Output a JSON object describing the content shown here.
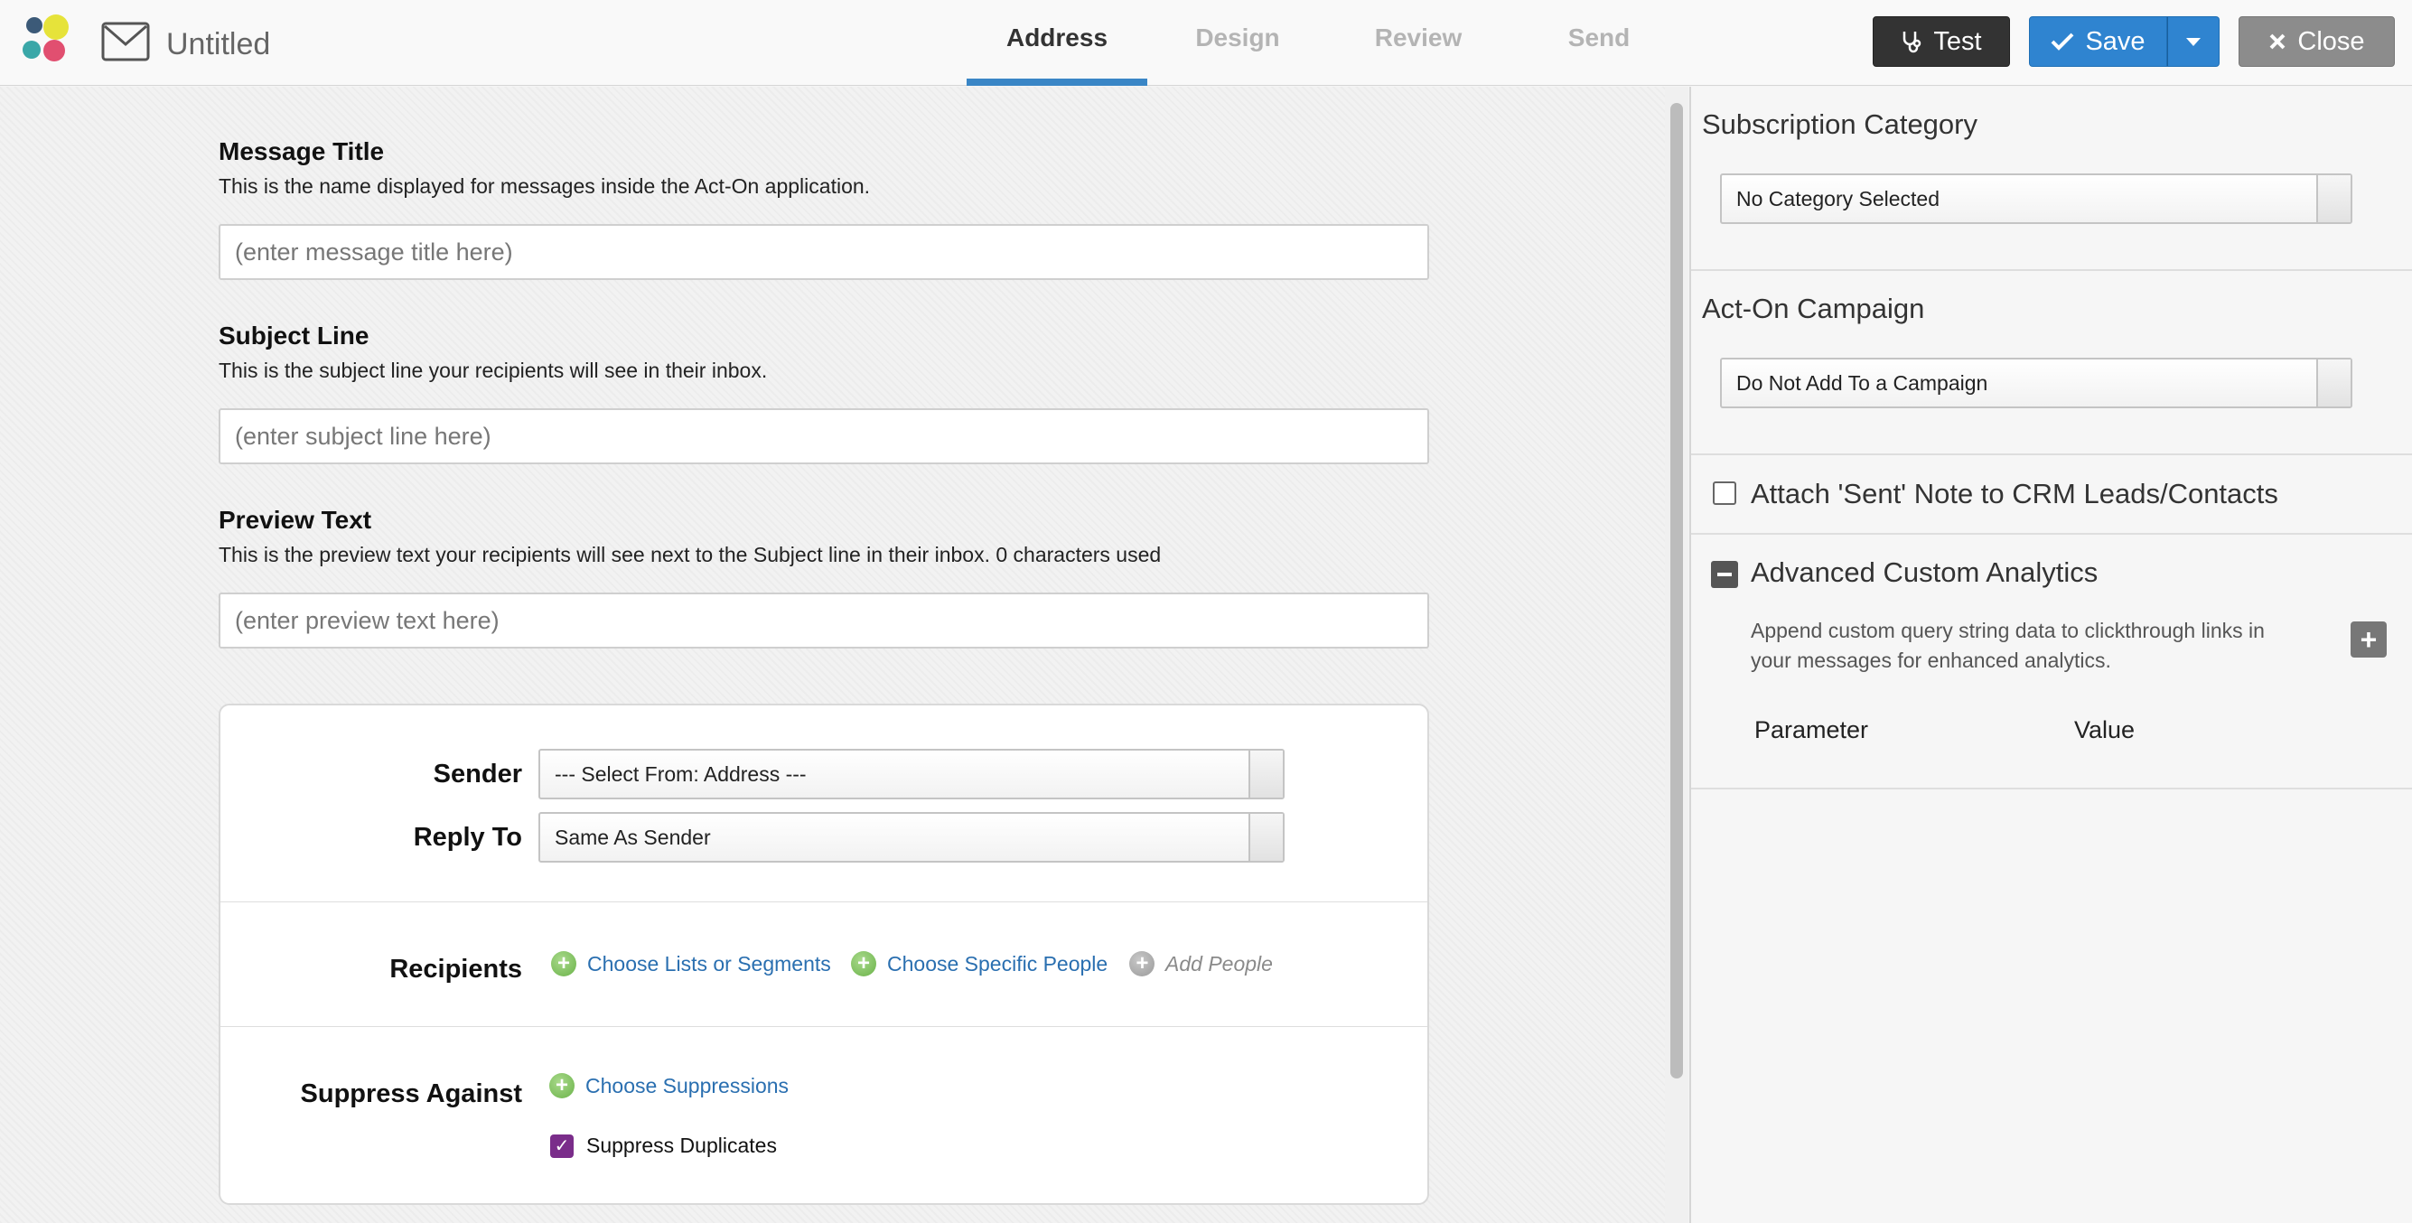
{
  "header": {
    "document_title": "Untitled",
    "tabs": [
      {
        "label": "Address",
        "active": true
      },
      {
        "label": "Design",
        "active": false
      },
      {
        "label": "Review",
        "active": false
      },
      {
        "label": "Send",
        "active": false
      }
    ],
    "buttons": {
      "test": "Test",
      "save": "Save",
      "close": "Close"
    },
    "accent_color": "#3a86c6"
  },
  "form": {
    "message_title": {
      "label": "Message Title",
      "help": "This is the name displayed for messages inside the Act-On application.",
      "placeholder": "(enter message title here)"
    },
    "subject_line": {
      "label": "Subject Line",
      "help": "This is the subject line your recipients will see in their inbox.",
      "placeholder": "(enter subject line here)"
    },
    "preview_text": {
      "label": "Preview Text",
      "help": "This is the preview text your recipients will see next to the Subject line in their inbox. 0 characters used",
      "placeholder": "(enter preview text here)"
    }
  },
  "card": {
    "sender": {
      "label": "Sender",
      "value": "--- Select From: Address ---"
    },
    "reply_to": {
      "label": "Reply To",
      "value": "Same As Sender"
    },
    "recipients": {
      "label": "Recipients",
      "links": [
        "Choose Lists or Segments",
        "Choose Specific People",
        "Add People"
      ]
    },
    "suppress": {
      "label": "Suppress Against",
      "link": "Choose Suppressions",
      "duplicates_label": "Suppress Duplicates",
      "duplicates_checked": true
    }
  },
  "right_panel": {
    "subscription": {
      "heading": "Subscription Category",
      "value": "No Category Selected"
    },
    "campaign": {
      "heading": "Act-On Campaign",
      "value": "Do Not Add To a Campaign"
    },
    "crm_note": {
      "label": "Attach 'Sent' Note to CRM Leads/Contacts",
      "checked": false
    },
    "analytics": {
      "heading": "Advanced Custom Analytics",
      "description": "Append custom query string data to clickthrough links in your messages for enhanced analytics.",
      "columns": [
        "Parameter",
        "Value"
      ]
    }
  }
}
